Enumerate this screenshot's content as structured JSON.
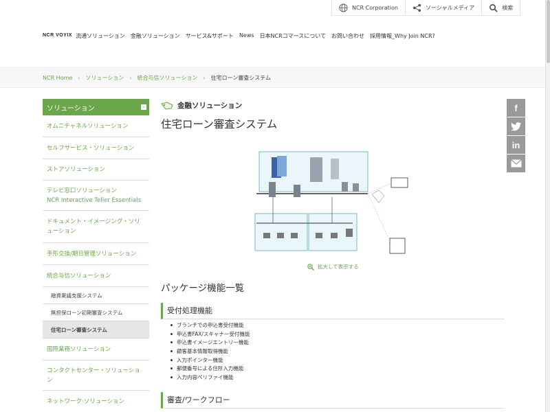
{
  "utility": {
    "corporate": "NCR Corporation",
    "social_media": "ソーシャルメディア",
    "search": "検索"
  },
  "logo": "NCR VOYIX",
  "nav": {
    "items": [
      "流通ソリューション",
      "金融ソリューション",
      "サービス&サポート",
      "News",
      "日本NCRコマースについて",
      "お問い合わせ",
      "採用情報_Why Join NCR?"
    ]
  },
  "breadcrumb": {
    "items": [
      "NCR Home",
      "ソリューション",
      "統合与信ソリューション"
    ],
    "current": "住宅ローン審査システム"
  },
  "sidebar": {
    "heading": "ソリューション",
    "items": [
      "オムニチャネルソリューション",
      "セルフサービス・ソリューション",
      "ストアソリューション",
      "テレビ窓口ソリューション",
      "NCR Interactive Teller Essentials",
      "ドキュメント・イメージング・ソリューション",
      "手形交換/期日管理ソリューション",
      "統合与信ソリューション"
    ],
    "subitems": [
      "融資稟議支援システム",
      "無担保ローン初期審査システム",
      "住宅ローン審査システム"
    ],
    "after": [
      "国際業務ソリューション",
      "コンタクトセンター・ソリューション",
      "ネットワーク·ソリューション"
    ]
  },
  "main": {
    "category": "金融ソリューション",
    "title": "住宅ローン審査システム",
    "zoom_label": "拡大して表示する",
    "package_heading": "パッケージ機能一覧",
    "section1": "受付処理機能",
    "features": [
      "ブランチでの申込書受付機能",
      "申込書FAX/スキャナー受付機能",
      "申込書イメージエントリー機能",
      "顧客基本情報取得機能",
      "入力ポインター機能",
      "郵便番号による住所入力機能",
      "入力内容ベリファイ機能"
    ],
    "section2": "審査/ワークフロー"
  },
  "social": {
    "icons": [
      "facebook-icon",
      "twitter-icon",
      "linkedin-icon",
      "mail-icon"
    ]
  },
  "colors": {
    "accent": "#6aa64a",
    "social_bg": "#9a9a9a"
  }
}
